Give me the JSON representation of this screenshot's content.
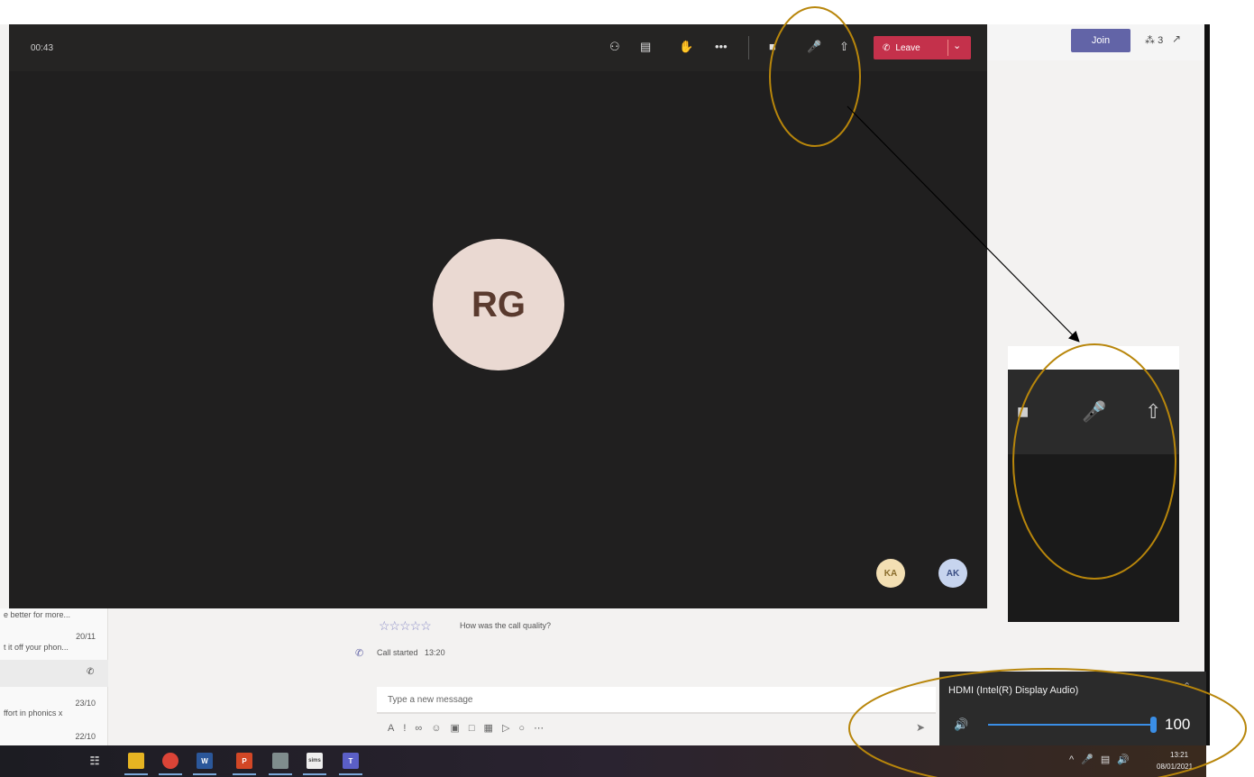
{
  "meeting": {
    "timer": "00:43",
    "leave_label": "Leave",
    "presenter_initials": "RG",
    "participants": [
      "KA",
      "AK"
    ]
  },
  "header": {
    "join_label": "Join",
    "participant_count": "3"
  },
  "chat_list": [
    {
      "date": "",
      "preview": "e better for more..."
    },
    {
      "date": "20/11",
      "preview": "t it off your phon..."
    },
    {
      "date": "23/10",
      "preview": "ffort in phonics x"
    },
    {
      "date": "22/10",
      "preview": ""
    }
  ],
  "conversation": {
    "quality_question": "How was the call quality?",
    "call_started_label": "Call started",
    "call_started_time": "13:20",
    "compose_placeholder": "Type a new message"
  },
  "volume_flyout": {
    "device_name": "HDMI  (Intel(R) Display Audio)",
    "volume_value": "100",
    "volume_level": 1.0
  },
  "taskbar": {
    "clock_time": "13:21",
    "clock_date": "08/01/2021",
    "apps": [
      "task-view",
      "file-explorer",
      "chrome",
      "word",
      "powerpoint",
      "app-generic",
      "sims",
      "teams"
    ]
  },
  "colors": {
    "leave_red": "#c4314b",
    "teams_purple": "#6264a7",
    "annotation_gold": "#b8860b",
    "slider_blue": "#3a8ee6"
  }
}
